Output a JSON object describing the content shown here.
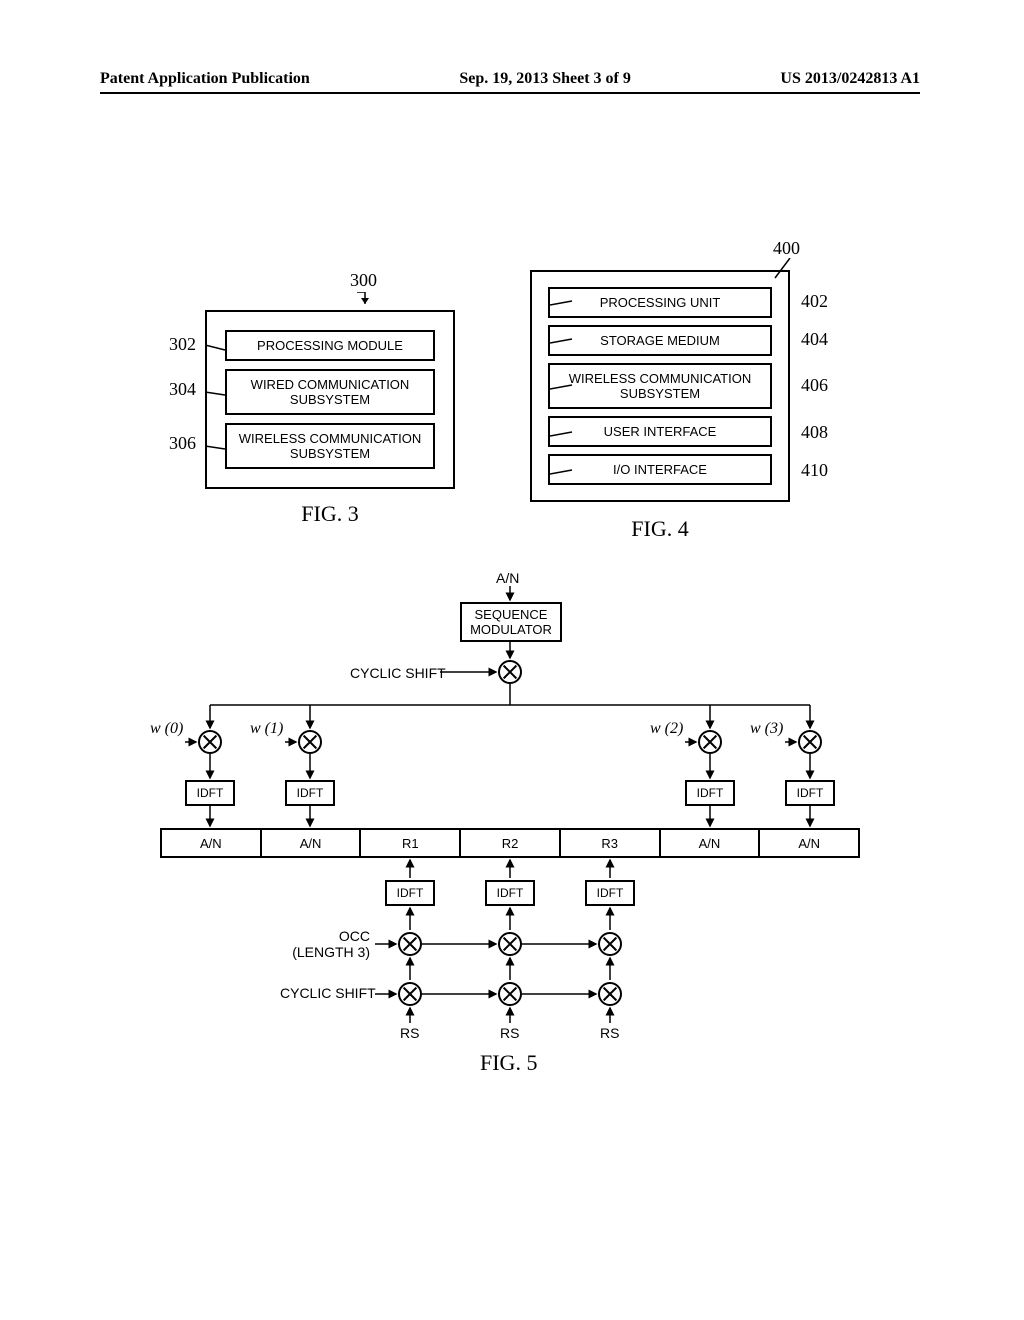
{
  "header": {
    "left": "Patent Application Publication",
    "center": "Sep. 19, 2013  Sheet 3 of 9",
    "right": "US 2013/0242813 A1"
  },
  "fig3": {
    "ref": "300",
    "items": [
      {
        "ref": "302",
        "text": "PROCESSING MODULE"
      },
      {
        "ref": "304",
        "text": "WIRED COMMUNICATION\nSUBSYSTEM"
      },
      {
        "ref": "306",
        "text": "WIRELESS COMMUNICATION\nSUBSYSTEM"
      }
    ],
    "caption": "FIG. 3"
  },
  "fig4": {
    "ref": "400",
    "items": [
      {
        "ref": "402",
        "text": "PROCESSING UNIT"
      },
      {
        "ref": "404",
        "text": "STORAGE MEDIUM"
      },
      {
        "ref": "406",
        "text": "WIRELESS COMMUNICATION\nSUBSYSTEM"
      },
      {
        "ref": "408",
        "text": "USER INTERFACE"
      },
      {
        "ref": "410",
        "text": "I/O INTERFACE"
      }
    ],
    "caption": "FIG. 4"
  },
  "fig5": {
    "input": "A/N",
    "modulator": "SEQUENCE\nMODULATOR",
    "cyclic_shift": "CYCLIC SHIFT",
    "weights": [
      "w (0)",
      "w (1)",
      "w (2)",
      "w (3)"
    ],
    "idft": "IDFT",
    "slot_cells": [
      "A/N",
      "A/N",
      "R1",
      "R2",
      "R3",
      "A/N",
      "A/N"
    ],
    "occ": "OCC\n(LENGTH 3)",
    "rs": "RS",
    "caption": "FIG. 5"
  },
  "chart_data": {
    "type": "diagram",
    "figures": [
      {
        "id": "FIG. 3",
        "ref": 300,
        "blocks": [
          {
            "ref": 302,
            "label": "PROCESSING MODULE"
          },
          {
            "ref": 304,
            "label": "WIRED COMMUNICATION SUBSYSTEM"
          },
          {
            "ref": 306,
            "label": "WIRELESS COMMUNICATION SUBSYSTEM"
          }
        ]
      },
      {
        "id": "FIG. 4",
        "ref": 400,
        "blocks": [
          {
            "ref": 402,
            "label": "PROCESSING UNIT"
          },
          {
            "ref": 404,
            "label": "STORAGE MEDIUM"
          },
          {
            "ref": 406,
            "label": "WIRELESS COMMUNICATION SUBSYSTEM"
          },
          {
            "ref": 408,
            "label": "USER INTERFACE"
          },
          {
            "ref": 410,
            "label": "I/O INTERFACE"
          }
        ]
      },
      {
        "id": "FIG. 5",
        "description": "PUCCH format 1a/1b slot structure",
        "top_chain": [
          "A/N",
          "SEQUENCE MODULATOR",
          "multiply(CYCLIC SHIFT)"
        ],
        "spreading_weights": [
          "w(0)",
          "w(1)",
          "w(2)",
          "w(3)"
        ],
        "per_branch": "IDFT",
        "slot_symbols": [
          "A/N",
          "A/N",
          "R1",
          "R2",
          "R3",
          "A/N",
          "A/N"
        ],
        "rs_chain": {
          "inputs": [
            "RS",
            "RS",
            "RS"
          ],
          "ops": [
            "multiply(CYCLIC SHIFT)",
            "multiply(OCC LENGTH 3)",
            "IDFT"
          ],
          "outputs": [
            "R1",
            "R2",
            "R3"
          ]
        }
      }
    ]
  }
}
